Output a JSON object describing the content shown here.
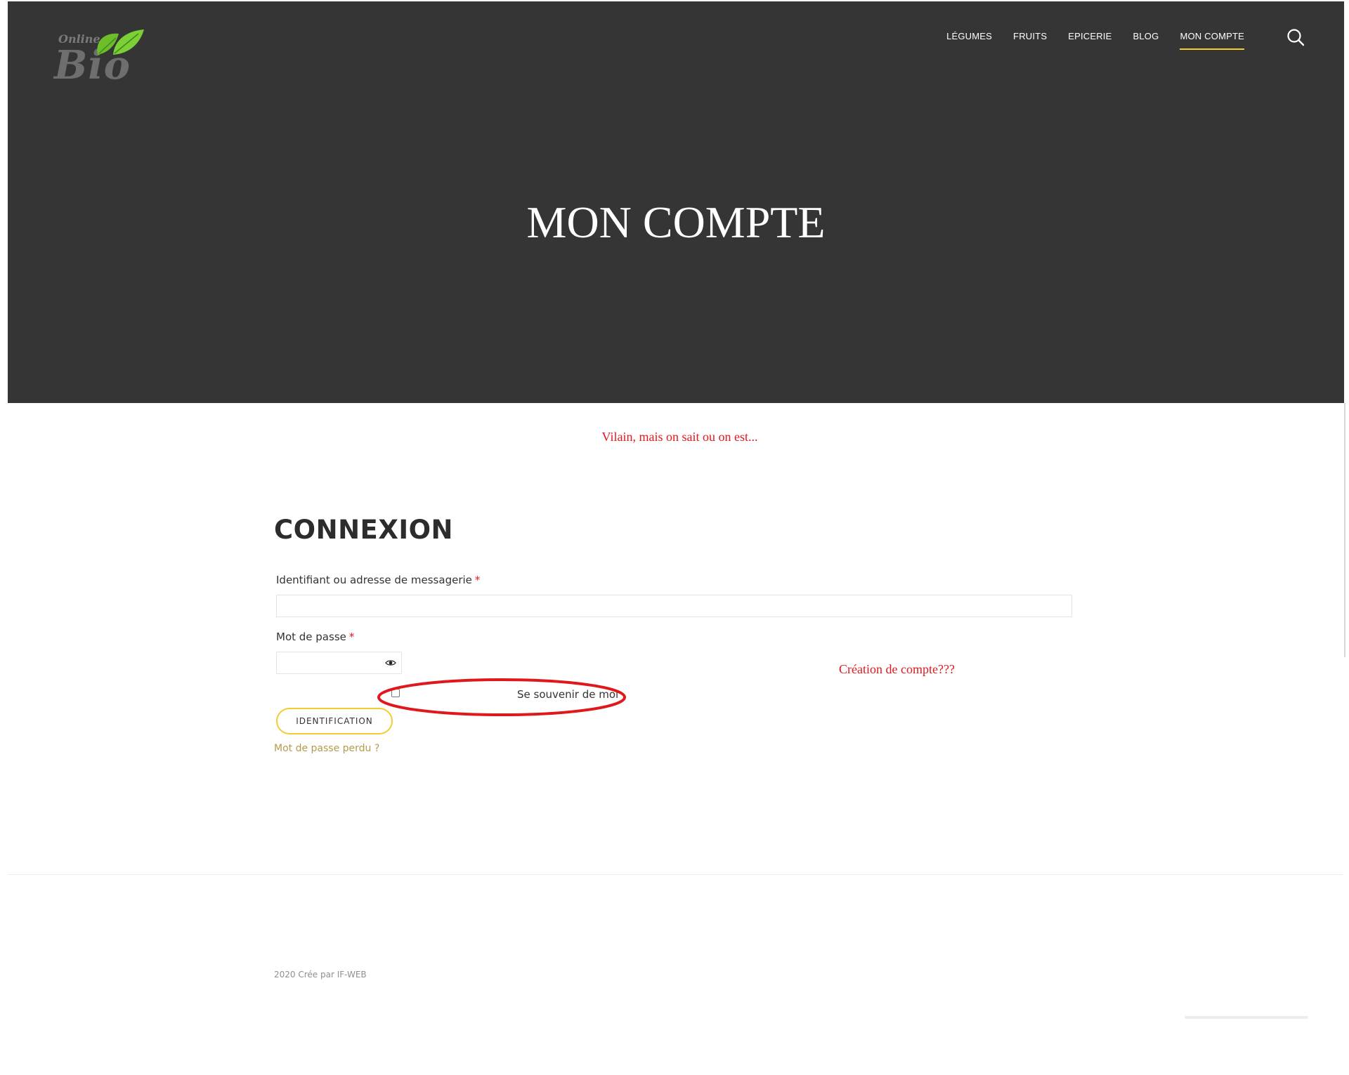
{
  "brand": {
    "logo_small": "Online",
    "logo_big": "Bio",
    "leaf_color": "#6cbf2a"
  },
  "nav": {
    "items": [
      "LÉGUMES",
      "FRUITS",
      "EPICERIE",
      "BLOG",
      "MON COMPTE"
    ],
    "active": "MON COMPTE",
    "search_icon": "search-icon"
  },
  "hero": {
    "title": "MON COMPTE",
    "background": "#353535"
  },
  "annotations": {
    "top": "Vilain, mais on sait ou on est...",
    "right": "Création de compte???",
    "color": "#e0181c"
  },
  "login": {
    "title": "CONNEXION",
    "username_label": "Identifiant ou adresse de messagerie",
    "username_value": "",
    "password_label": "Mot de passe",
    "password_value": "",
    "required_mark": "*",
    "remember_label": "Se souvenir de moi",
    "remember_checked": false,
    "submit_label": "IDENTIFICATION",
    "lost_password": "Mot de passe perdu ?",
    "accent": "#f2cd32"
  },
  "footer": {
    "credit": "2020 Crée par IF-WEB"
  }
}
